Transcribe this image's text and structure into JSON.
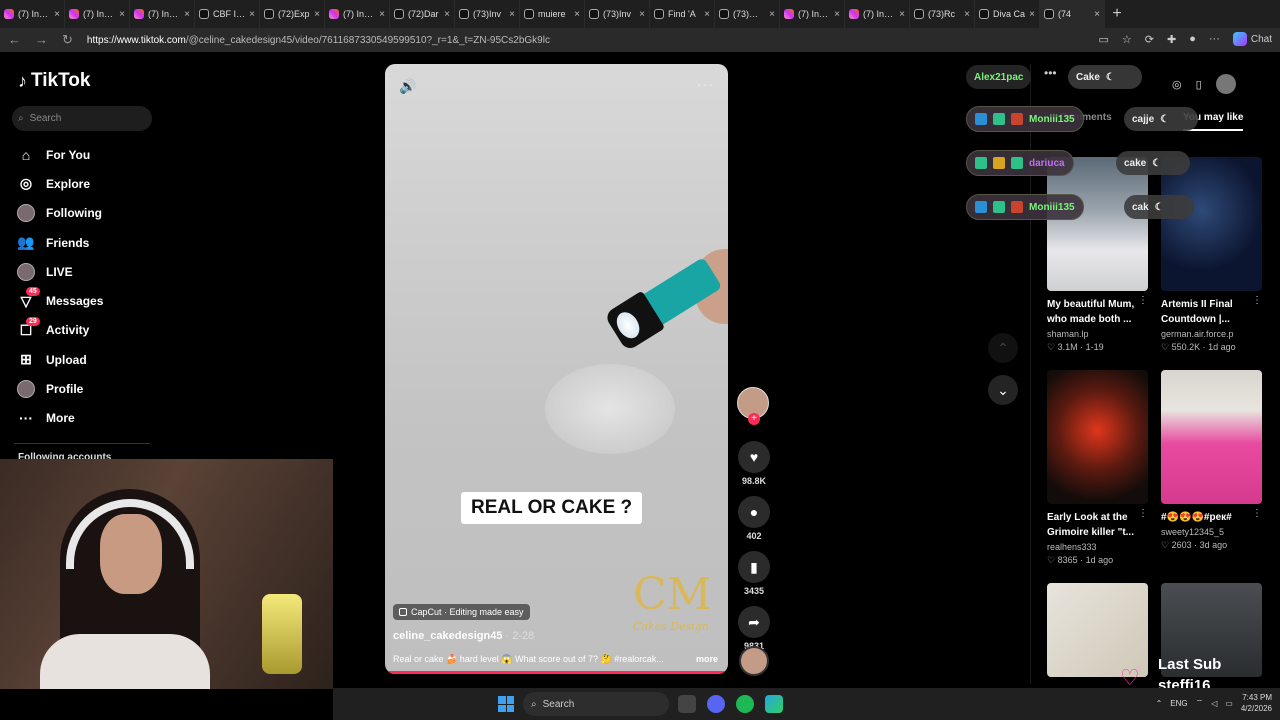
{
  "browser": {
    "tabs": [
      {
        "title": "(7) Insta",
        "icon": "ig"
      },
      {
        "title": "(7) Insta",
        "icon": "ig"
      },
      {
        "title": "(7) Insta",
        "icon": "ig"
      },
      {
        "title": "CBF Ise",
        "icon": "tt"
      },
      {
        "title": "(72)Exp",
        "icon": "tt"
      },
      {
        "title": "(7) Insta",
        "icon": "ig"
      },
      {
        "title": "(72)Dar",
        "icon": "tt"
      },
      {
        "title": "(73)Inv",
        "icon": "tt"
      },
      {
        "title": "muiere",
        "icon": "tt"
      },
      {
        "title": "(73)Inv",
        "icon": "tt"
      },
      {
        "title": "Find 'A",
        "icon": "tt"
      },
      {
        "title": "(73)@M",
        "icon": "tt"
      },
      {
        "title": "(7) Insta",
        "icon": "ig"
      },
      {
        "title": "(7) Insta",
        "icon": "ig"
      },
      {
        "title": "(73)Rc",
        "icon": "tt"
      },
      {
        "title": "Diva Ca",
        "icon": "tt"
      },
      {
        "title": "(74",
        "icon": "tt"
      }
    ],
    "url_host": "https://www.tiktok.com",
    "url_path": "/@celine_cakedesign45/video/7611687330549599510?_r=1&_t=ZN-95Cs2bGk9lc",
    "chat_label": "Chat"
  },
  "sidebar": {
    "logo": "TikTok",
    "search_placeholder": "Search",
    "items": [
      {
        "label": "For You",
        "icon": "home-icon",
        "glyph": "⌂"
      },
      {
        "label": "Explore",
        "icon": "compass-icon",
        "glyph": "◎"
      },
      {
        "label": "Following",
        "icon": "following-avatar-icon",
        "glyph": ""
      },
      {
        "label": "Friends",
        "icon": "friends-icon",
        "glyph": "👥"
      },
      {
        "label": "LIVE",
        "icon": "live-icon",
        "glyph": ""
      },
      {
        "label": "Messages",
        "icon": "messages-icon",
        "glyph": "▽",
        "badge": "45"
      },
      {
        "label": "Activity",
        "icon": "activity-icon",
        "glyph": "☐",
        "badge": "29"
      },
      {
        "label": "Upload",
        "icon": "upload-icon",
        "glyph": "⊞"
      },
      {
        "label": "Profile",
        "icon": "profile-icon",
        "glyph": ""
      },
      {
        "label": "More",
        "icon": "more-icon",
        "glyph": "···"
      }
    ],
    "following_accounts": "Following accounts"
  },
  "video": {
    "caption": "REAL OR CAKE ?",
    "watermark": "CM",
    "watermark_sub": "Cakes Design",
    "capcut": "CapCut · Editing made easy",
    "author": "celine_cakedesign45",
    "date": " · 2-28",
    "description": "Real or cake 🍰 hard level 😱 What score out of 7? 🤔 #realorcak...",
    "more": "more"
  },
  "actions": {
    "likes": "98.8K",
    "comments": "402",
    "saves": "3435",
    "shares": "9831"
  },
  "chat": {
    "top_name": "Alex21pac",
    "top_msg": "Cake",
    "rows": [
      {
        "name": "Moniii135",
        "msg": "cajje"
      },
      {
        "name": "dariuca",
        "msg": "cake"
      },
      {
        "name": "Moniii135",
        "msg": "cak"
      }
    ]
  },
  "right_panel": {
    "tab_comments": "Comments",
    "tab_you_may_like": "You may like",
    "cards": [
      {
        "title": "My beautiful Mum, who made both ...",
        "author": "shaman.lp",
        "likes": "3.1M",
        "age": "1-19"
      },
      {
        "title": "Artemis II Final Countdown |...",
        "author": "german.air.force.p",
        "likes": "550.2K",
        "age": "1d ago"
      },
      {
        "title": "Early Look at the Grimoire killer \"t...",
        "author": "realhens333",
        "likes": "8365",
        "age": "1d ago"
      },
      {
        "title": "#😍😍😍#рек#",
        "author": "sweety12345_5",
        "likes": "2603",
        "age": "3d ago"
      }
    ]
  },
  "stream_overlay": {
    "last_sub_label": "Last Sub",
    "last_sub_name": "steffi16"
  },
  "taskbar": {
    "search": "Search",
    "lang": "ENG",
    "time": "7:43 PM",
    "date": "4/2/2026"
  }
}
